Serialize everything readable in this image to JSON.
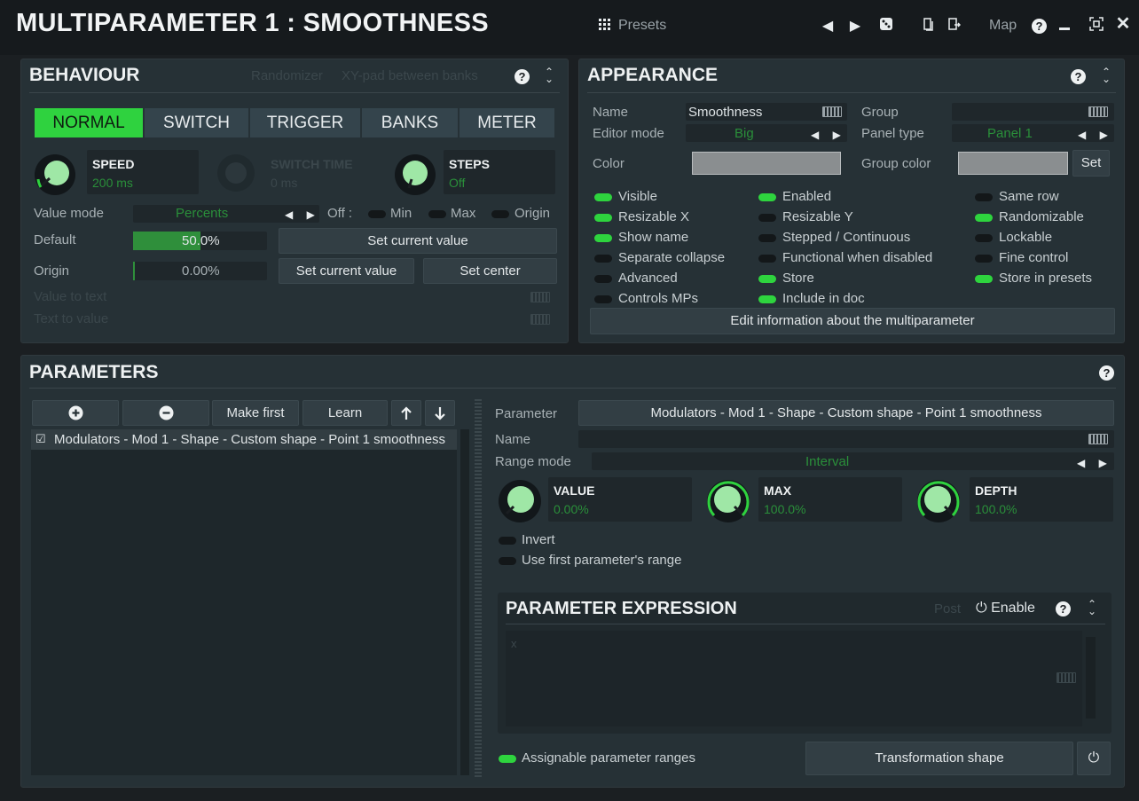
{
  "window": {
    "title": "MULTIPARAMETER 1 : SMOOTHNESS",
    "presets_label": "Presets",
    "map_label": "Map"
  },
  "behaviour": {
    "title": "BEHAVIOUR",
    "randomizer_label": "Randomizer",
    "xy_pad_label": "XY-pad between banks",
    "tabs": [
      "NORMAL",
      "SWITCH",
      "TRIGGER",
      "BANKS",
      "METER"
    ],
    "active_tab": "NORMAL",
    "speed": {
      "label": "SPEED",
      "value": "200 ms"
    },
    "switch_time": {
      "label": "SWITCH TIME",
      "value": "0 ms"
    },
    "steps": {
      "label": "STEPS",
      "value": "Off"
    },
    "value_mode": {
      "label": "Value mode",
      "value": "Percents",
      "off_label": "Off :",
      "min_label": "Min",
      "max_label": "Max",
      "origin_label": "Origin"
    },
    "default": {
      "label": "Default",
      "value": "50.0%",
      "fill_fraction": 0.5
    },
    "origin": {
      "label": "Origin",
      "value": "0.00%",
      "fill_fraction": 0.0
    },
    "set_current_value_label": "Set current value",
    "set_center_label": "Set center",
    "value_to_text_label": "Value to text",
    "text_to_value_label": "Text to value"
  },
  "appearance": {
    "title": "APPEARANCE",
    "name_label": "Name",
    "name_value": "Smoothness",
    "group_label": "Group",
    "group_value": "",
    "editor_mode_label": "Editor mode",
    "editor_mode_value": "Big",
    "panel_type_label": "Panel type",
    "panel_type_value": "Panel 1",
    "color_label": "Color",
    "group_color_label": "Group color",
    "set_label": "Set",
    "color_value": "#8a8e90",
    "toggles": [
      {
        "label": "Visible",
        "on": true
      },
      {
        "label": "Resizable X",
        "on": true
      },
      {
        "label": "Show name",
        "on": true
      },
      {
        "label": "Separate collapse",
        "on": false
      },
      {
        "label": "Advanced",
        "on": false
      },
      {
        "label": "Controls MPs",
        "on": false
      },
      {
        "label": "Enabled",
        "on": true
      },
      {
        "label": "Resizable Y",
        "on": false
      },
      {
        "label": "Stepped / Continuous",
        "on": false
      },
      {
        "label": "Functional when disabled",
        "on": false
      },
      {
        "label": "Store",
        "on": true
      },
      {
        "label": "Include in doc",
        "on": true
      },
      {
        "label": "Same row",
        "on": false
      },
      {
        "label": "Randomizable",
        "on": true
      },
      {
        "label": "Lockable",
        "on": false
      },
      {
        "label": "Fine control",
        "on": false
      },
      {
        "label": "Store in presets",
        "on": true
      }
    ],
    "edit_info_label": "Edit information about the multiparameter"
  },
  "parameters": {
    "title": "PARAMETERS",
    "make_first_label": "Make first",
    "learn_label": "Learn",
    "list_items": [
      "Modulators - Mod 1 - Shape - Custom shape - Point 1 smoothness"
    ],
    "parameter_label": "Parameter",
    "parameter_value": "Modulators - Mod 1 - Shape - Custom shape - Point 1 smoothness",
    "name_label": "Name",
    "name_value": "",
    "range_mode_label": "Range mode",
    "range_mode_value": "Interval",
    "value_knob": {
      "label": "VALUE",
      "value": "0.00%"
    },
    "max_knob": {
      "label": "MAX",
      "value": "100.0%"
    },
    "depth_knob": {
      "label": "DEPTH",
      "value": "100.0%"
    },
    "invert_label": "Invert",
    "use_first_range_label": "Use first parameter's range",
    "assignable_ranges_label": "Assignable parameter ranges",
    "transformation_shape_label": "Transformation shape"
  },
  "expression": {
    "title": "PARAMETER EXPRESSION",
    "post_label": "Post",
    "enable_label": "Enable",
    "code_text": "x"
  },
  "colors": {
    "accent_green": "#2fd23f",
    "panel_bg": "#263136",
    "window_bg": "#1b1f22"
  }
}
